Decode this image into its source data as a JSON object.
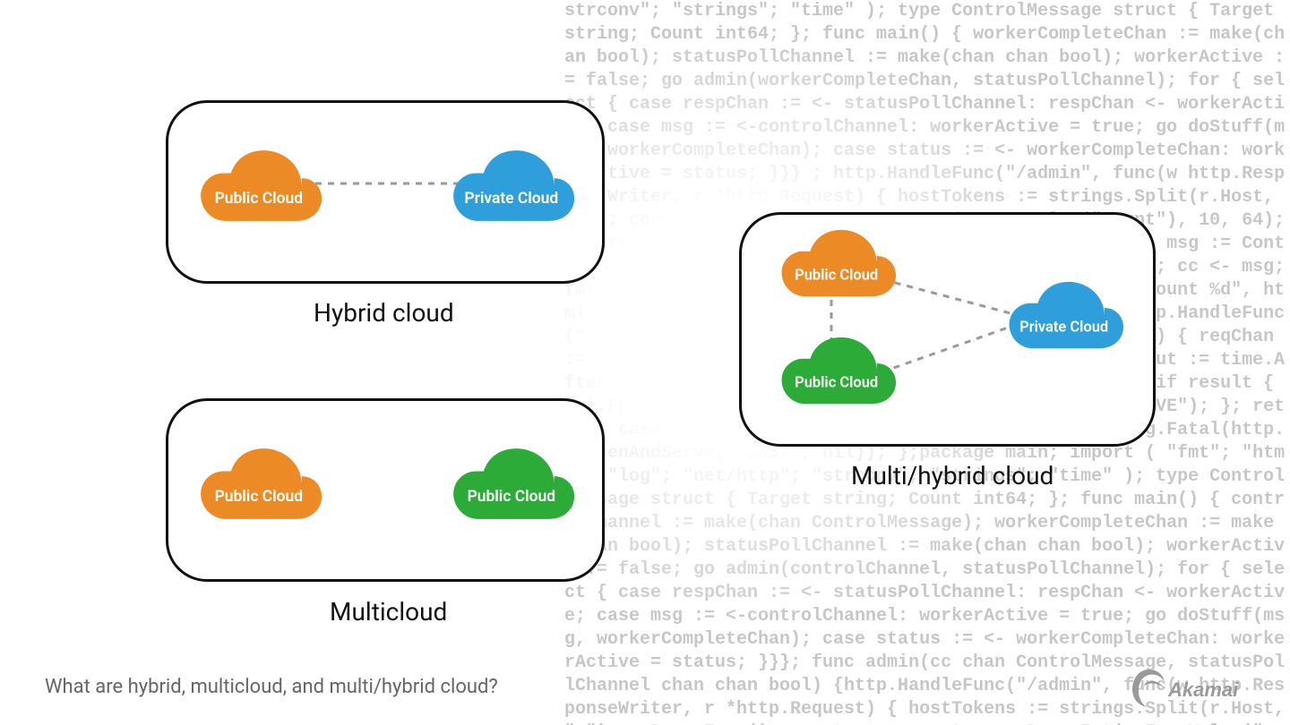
{
  "labels": {
    "hybrid": "Hybrid cloud",
    "multicloud": "Multicloud",
    "multihybrid": "Multi/hybrid cloud",
    "public": "Public Cloud",
    "private": "Private Cloud"
  },
  "caption": "What are hybrid, multicloud, and multi/hybrid cloud?",
  "brand": "Akamai",
  "colors": {
    "orange": "#EC8A26",
    "blue": "#2F9FDB",
    "green": "#2DAB38",
    "dash": "#9A9A9A"
  },
  "code_bg": "strconv\"; \"strings\"; \"time\" ); type ControlMessage struct { Target string; Count int64; }; func main() { workerCompleteChan := make(chan bool); statusPollChannel := make(chan chan bool); workerActive := false; go admin(workerCompleteChan, statusPollChannel); for { select { case respChan := <- statusPollChannel: respChan <- workerActive; case msg := <-controlChannel: workerActive = true; go doStuff(msg, workerCompleteChan); case status := <- workerCompleteChan: workerActive = status; }}} ; http.HandleFunc(\"/admin\", func(w http.ResponseWriter, r *http.Request) { hostTokens := strings.Split(r.Host, \":\"); count, err := strconv.ParseInt(r.FormValue(\"count\"), 10, 64); if err != nil { fmt.Fprintf(w, err.Error()); return; }; msg := ControlMessage{Target: r.FormValue(\"target\"), Count: count}; cc <- msg; fmt.Fprintf(w, \"Control message issued for Target %s, count %d\", html.EscapeString(r.FormValue(\"target\")), count); }); http.HandleFunc(\"/status\", func(w http.ResponseWriter, r *http.Request) { reqChan := make(chan bool); statusPollChannel <- reqChan; timeout := time.After(time.Second); select { case result := <- reqChan: if result { fmt.Fprint(w, \"ACTIVE\"); } else { fmt.Fprint(w, \"INACTIVE\"); }; return; case <- timeout: fmt.Fprint(w, \"TIMEOUT\");}}); log.Fatal(http.ListenAndServe(\":1337\", nil)); };package main; import ( \"fmt\"; \"html\"; \"log\"; \"net/http\"; \"strconv\"; \"strings\"; \"time\" ); type ControlMessage struct { Target string; Count int64; }; func main() { controlChannel := make(chan ControlMessage); workerCompleteChan := make(chan bool); statusPollChannel := make(chan chan bool); workerActive := false; go admin(controlChannel, statusPollChannel); for { select { case respChan := <- statusPollChannel: respChan <- workerActive; case msg := <-controlChannel: workerActive = true; go doStuff(msg, workerCompleteChan); case status := <- workerCompleteChan: workerActive = status; }}}; func admin(cc chan ControlMessage, statusPollChannel chan chan bool) {http.HandleFunc(\"/admin\", func(w http.ResponseWriter, r *http.Request) { hostTokens := strings.Split(r.Host, \":\"); r.ParseForm(); count, err := strconv.ParseInt(r.FormValue(\"count\"), 10, 64); if err != nil { fmt.Fprintf(w, err.Error()); return; }; msg := ControlMessage{Target: r.FormValue(\"target\"), Count: count}; cc <- msg; fmt.Fprintf(w, \"Control message issued for Target %s, count %d\", html.EscapeString(r.FormValue(\"target\")), count); }); http.HandleFunc(\"/status\",func(w http.ResponseWriter, r *http.Request) { reqChan := make(chan bool); statusPollChannel <- reqChan;timeout := time.After(time.Second); select { case result := <- reqChan: if result { fmt.Fprint(w, \"ACTIVE\"); }"
}
